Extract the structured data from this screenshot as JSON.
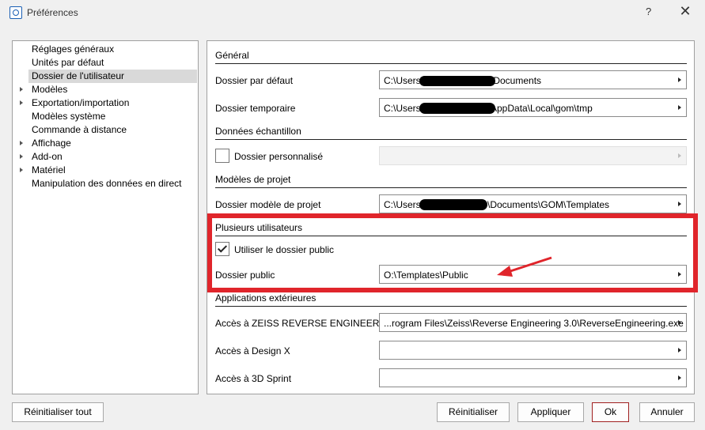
{
  "window": {
    "title": "Préférences",
    "help_label": "?",
    "close_label": "✕",
    "app_icon": "search-icon"
  },
  "tree": {
    "items": [
      {
        "label": "Réglages généraux",
        "expandable": false
      },
      {
        "label": "Unités par défaut",
        "expandable": false
      },
      {
        "label": "Dossier de l'utilisateur",
        "expandable": false,
        "selected": true
      },
      {
        "label": "Modèles",
        "expandable": true
      },
      {
        "label": "Exportation/importation",
        "expandable": true
      },
      {
        "label": "Modèles système",
        "expandable": false
      },
      {
        "label": "Commande à distance",
        "expandable": false
      },
      {
        "label": "Affichage",
        "expandable": true
      },
      {
        "label": "Add-on",
        "expandable": true
      },
      {
        "label": "Matériel",
        "expandable": true
      },
      {
        "label": "Manipulation des données en direct",
        "expandable": false
      }
    ]
  },
  "panel": {
    "general": {
      "title": "Général",
      "default_folder_label": "Dossier par défaut",
      "default_folder_value_a": "C:\\Users\\",
      "default_folder_value_b": "\\Documents",
      "temp_folder_label": "Dossier temporaire",
      "temp_folder_value_a": "C:\\Users\\",
      "temp_folder_value_b": "AppData\\Local\\gom\\tmp"
    },
    "sample": {
      "title": "Données échantillon",
      "custom_folder_label": "Dossier personnalisé",
      "custom_folder_checked": false,
      "custom_folder_value": ""
    },
    "templates": {
      "title": "Modèles de projet",
      "template_folder_label": "Dossier modèle de projet",
      "template_folder_value_a": "C:\\Users",
      "template_folder_value_b": "\\Documents\\GOM\\Templates"
    },
    "multiuser": {
      "title": "Plusieurs utilisateurs",
      "use_public_label": "Utiliser le dossier public",
      "use_public_checked": true,
      "public_folder_label": "Dossier public",
      "public_folder_value": "O:\\Templates\\Public"
    },
    "external": {
      "title": "Applications extérieures",
      "zeiss_label": "Accès à ZEISS REVERSE ENGINEERING",
      "zeiss_value": "...rogram Files\\Zeiss\\Reverse Engineering 3.0\\ReverseEngineering.exe",
      "designx_label": "Accès à Design X",
      "designx_value": "",
      "sprint_label": "Accès à 3D Sprint",
      "sprint_value": ""
    }
  },
  "buttons": {
    "reset_all": "Réinitialiser tout",
    "reset": "Réinitialiser",
    "apply": "Appliquer",
    "ok": "Ok",
    "cancel": "Annuler"
  },
  "colors": {
    "highlight": "#e0252b",
    "selected_bg": "#d9d9d9"
  }
}
